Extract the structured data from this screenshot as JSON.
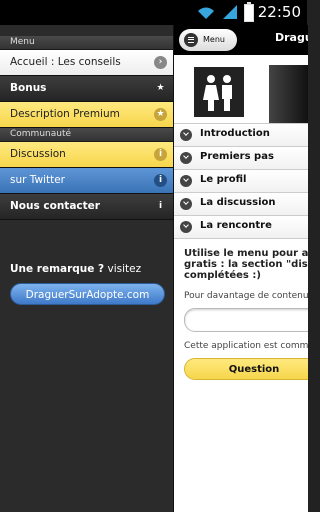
{
  "status": {
    "time": "22:50"
  },
  "menu": {
    "header": "Menu",
    "items": [
      {
        "label": "Accueil : Les conseils"
      },
      {
        "label": "Bonus"
      },
      {
        "label": "Description Premium"
      }
    ],
    "community_header": "Communauté",
    "community_items": [
      {
        "label": "Discussion"
      },
      {
        "label": "sur Twitter"
      },
      {
        "label": "Nous contacter"
      }
    ],
    "remark_bold": "Une remarque ?",
    "remark_rest": " visitez",
    "site_button": "DraguerSurAdopte.com"
  },
  "panel": {
    "menu_button": "Menu",
    "title": "Dragu",
    "sections": [
      "Introduction",
      "Premiers pas",
      "Le profil",
      "La discussion",
      "La rencontre"
    ],
    "notice_lines": [
      "Utilise le menu pour accé",
      "gratis : la section \"discus",
      "complétées :)"
    ],
    "info1": "Pour davantage de contenu",
    "info2": "Cette application est comm",
    "question_button": "Question"
  }
}
